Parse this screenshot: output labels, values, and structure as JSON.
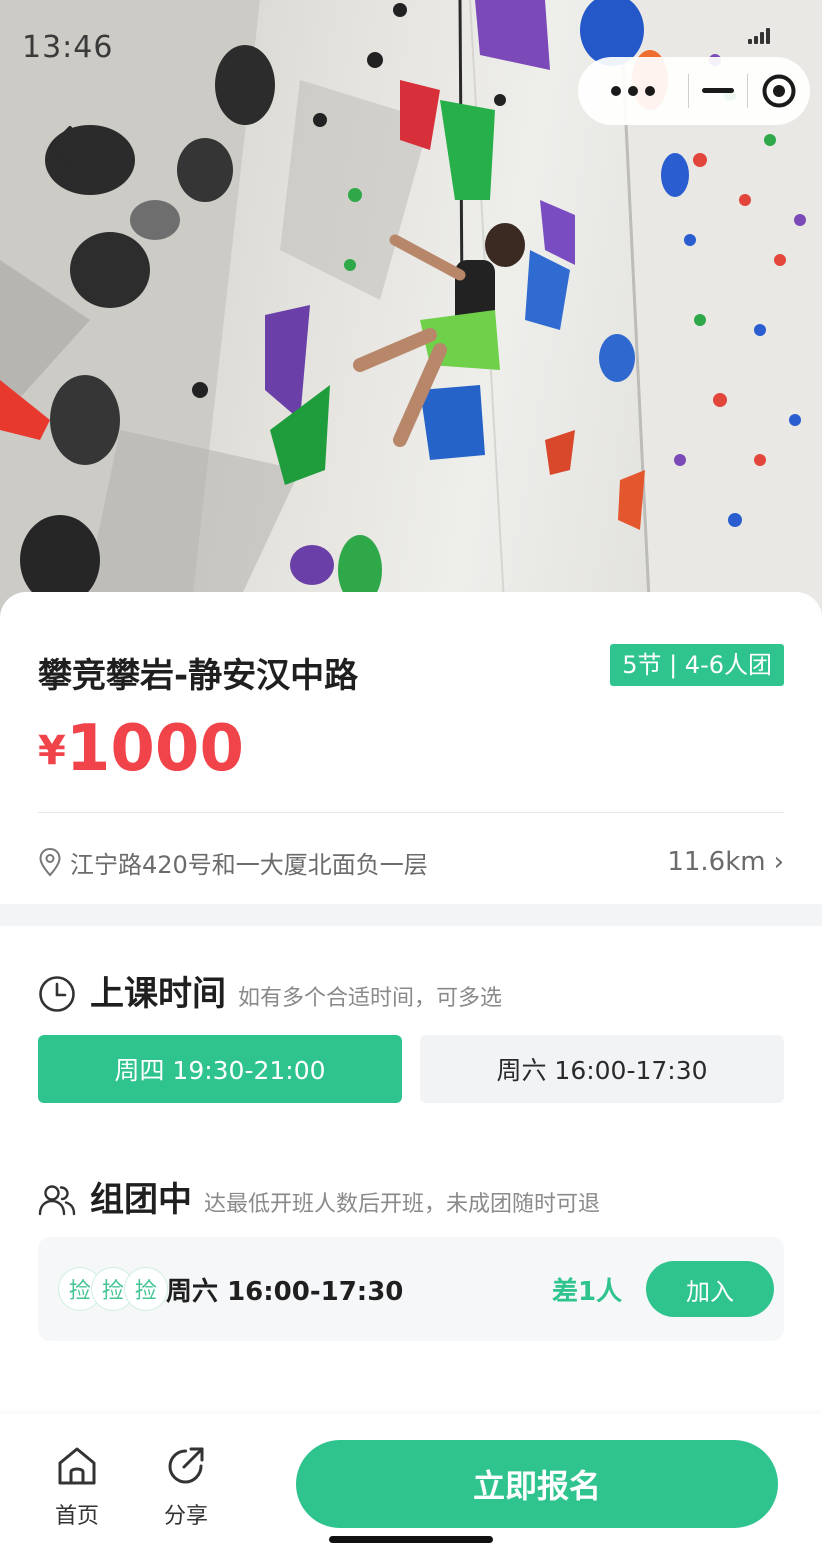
{
  "status_bar": {
    "time": "13:46"
  },
  "hero": {
    "back_icon": "chevron-left-icon",
    "menu_icons": [
      "more-dots-icon",
      "minimize-icon",
      "close-target-icon"
    ]
  },
  "course": {
    "title": "攀竞攀岩-静安汉中路",
    "tag": "5节 | 4-6人团",
    "currency": "¥",
    "price": "1000",
    "address": "江宁路420号和一大厦北面负一层",
    "distance": "11.6km",
    "distance_chevron": "›"
  },
  "schedule": {
    "title": "上课时间",
    "hint": "如有多个合适时间，可多选",
    "slots": [
      {
        "label": "周四 19:30-21:00",
        "selected": true
      },
      {
        "label": "周六 16:00-17:30",
        "selected": false
      }
    ]
  },
  "group": {
    "title": "组团中",
    "hint": "达最低开班人数后开班，未成团随时可退",
    "avatar_text": "捡",
    "day": "周六",
    "time": "16:00-17:30",
    "needed": "差1人",
    "join_label": "加入"
  },
  "bottom_bar": {
    "home_label": "首页",
    "share_label": "分享",
    "signup_label": "立即报名"
  },
  "colors": {
    "accent": "#2fc48e",
    "price": "#f1434a"
  }
}
